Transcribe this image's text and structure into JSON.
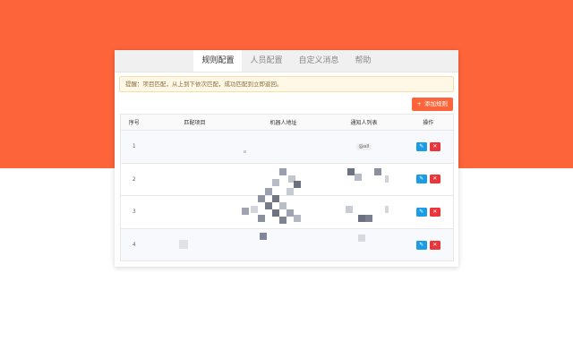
{
  "tabs": [
    {
      "label": "规则配置",
      "active": true
    },
    {
      "label": "人员配置",
      "active": false
    },
    {
      "label": "自定义消息",
      "active": false
    },
    {
      "label": "帮助",
      "active": false
    }
  ],
  "notice": "提醒：项目匹配，从上到下依次匹配，成功匹配到立即返回。",
  "add_button": {
    "icon": "+",
    "label": "添加规则"
  },
  "table": {
    "headers": [
      "序号",
      "匹配项目",
      "机器人地址",
      "通知人列表",
      "操作"
    ],
    "rows": [
      {
        "index": "1",
        "tag": "@all"
      },
      {
        "index": "2",
        "tag": ""
      },
      {
        "index": "3",
        "tag": ""
      },
      {
        "index": "4",
        "tag": ""
      }
    ],
    "edit_icon": "✎",
    "delete_icon": "✕"
  },
  "colors": {
    "brand": "#fe643a",
    "edit_button": "#1c9ce6",
    "delete_button": "#e8363b",
    "notice_bg": "#fff8e6"
  },
  "icons": {
    "edit": "pencil-icon",
    "delete": "close-icon",
    "add": "plus-icon"
  }
}
